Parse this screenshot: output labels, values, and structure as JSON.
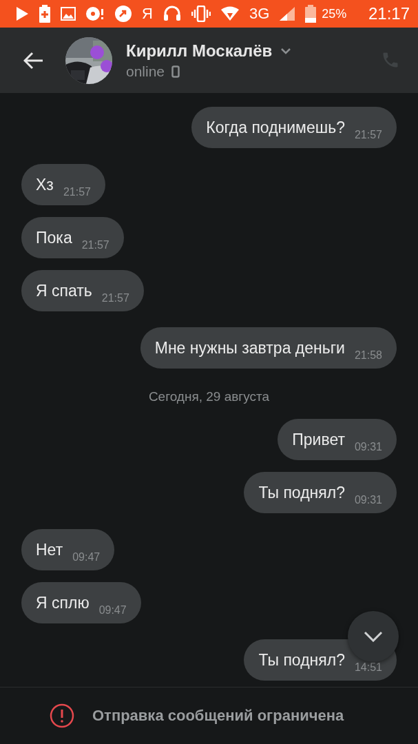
{
  "status_bar": {
    "carrier_glyph": "Я",
    "network": "3G",
    "battery": "25%",
    "time": "21:17"
  },
  "header": {
    "name": "Кирилл Москалёв",
    "status": "online"
  },
  "messages": [
    {
      "kind": "outgoing",
      "text": "Когда поднимешь?",
      "time": "21:57"
    },
    {
      "kind": "incoming",
      "text": "Хз",
      "time": "21:57"
    },
    {
      "kind": "incoming",
      "text": "Пока",
      "time": "21:57"
    },
    {
      "kind": "incoming",
      "text": "Я спать",
      "time": "21:57"
    },
    {
      "kind": "outgoing",
      "text": "Мне нужны завтра деньги",
      "time": "21:58"
    },
    {
      "kind": "date",
      "text": "Сегодня, 29 августа"
    },
    {
      "kind": "outgoing",
      "text": "Привет",
      "time": "09:31"
    },
    {
      "kind": "outgoing",
      "text": "Ты поднял?",
      "time": "09:31"
    },
    {
      "kind": "incoming",
      "text": "Нет",
      "time": "09:47"
    },
    {
      "kind": "incoming",
      "text": "Я сплю",
      "time": "09:47"
    },
    {
      "kind": "outgoing",
      "text": "Ты поднял?",
      "time": "14:51"
    }
  ],
  "notice": {
    "text": "Отправка сообщений ограничена"
  }
}
